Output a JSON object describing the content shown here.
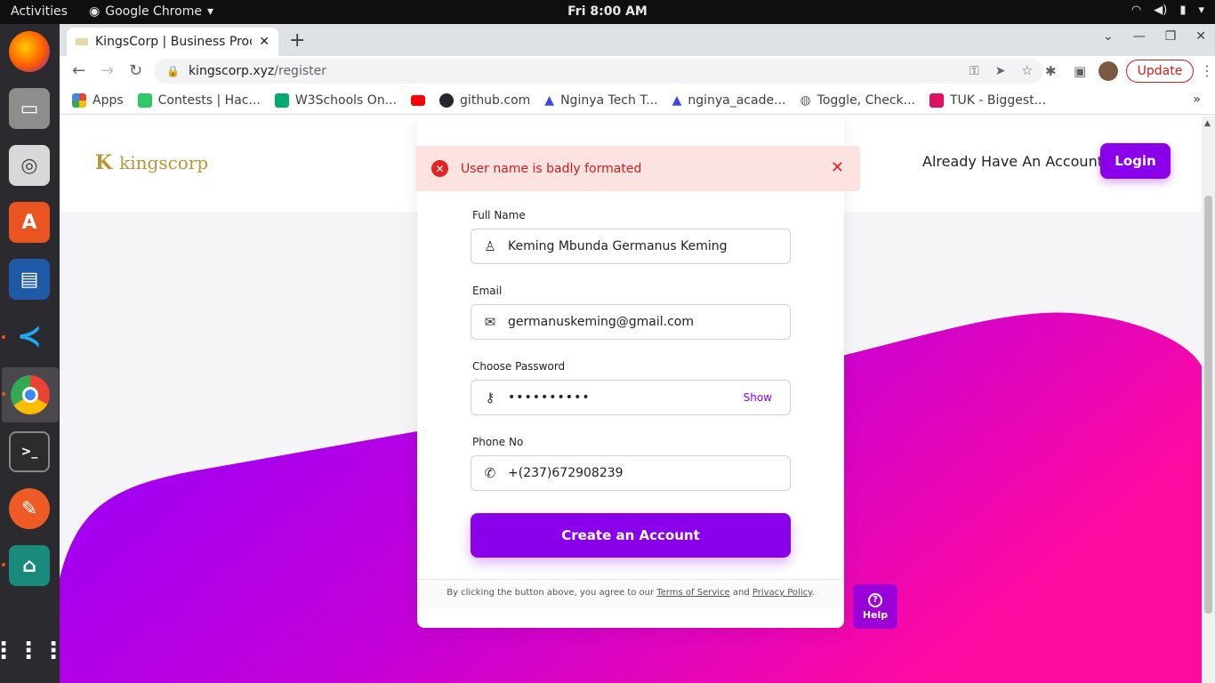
{
  "os": {
    "activities": "Activities",
    "app_name": "Google Chrome",
    "clock": "Fri  8:00 AM"
  },
  "dock": {
    "items": [
      "firefox-icon",
      "files-icon",
      "rhythmbox-icon",
      "software-center-icon",
      "writer-icon",
      "vscode-icon",
      "chrome-icon",
      "terminal-icon",
      "postman-icon",
      "android-studio-icon",
      "show-apps-icon"
    ]
  },
  "browser": {
    "tab_title": "KingsCorp | Business Proc",
    "url_host": "kingscorp.xyz",
    "url_path": "/register",
    "update_label": "Update",
    "bookmarks": [
      {
        "label": "Apps",
        "color": "#ea4335"
      },
      {
        "label": "Contests | Hac...",
        "color": "#2ec866"
      },
      {
        "label": "W3Schools On...",
        "color": "#04aa6d"
      },
      {
        "label": "",
        "color": "#ff0000"
      },
      {
        "label": "github.com",
        "color": "#24292f"
      },
      {
        "label": "Nginya Tech T...",
        "color": "#3b49df"
      },
      {
        "label": "nginya_acade...",
        "color": "#3b49df"
      },
      {
        "label": "Toggle, Check...",
        "color": "#5f6368"
      },
      {
        "label": "TUK - Biggest...",
        "color": "#e0115f"
      }
    ]
  },
  "page": {
    "logo_text": "kingscorp",
    "already_text": "Already Have An Account?",
    "login_label": "Login",
    "toast_message": "User name is badly formated",
    "form": {
      "full_name_label": "Full Name",
      "full_name_value": "Keming Mbunda Germanus Keming",
      "email_label": "Email",
      "email_value": "germanuskeming@gmail.com",
      "password_label": "Choose Password",
      "password_value": "••••••••••",
      "show_label": "Show",
      "phone_label": "Phone No",
      "phone_value": "+(237)672908239",
      "submit_label": "Create an Account"
    },
    "terms": {
      "prefix": "By clicking the button above, you agree to our ",
      "tos": "Terms of Service",
      "and": " and ",
      "privacy": "Privacy Policy",
      "suffix": "."
    },
    "help_label": "Help"
  },
  "colors": {
    "accent": "#8b00ea",
    "wave_start": "#9000ff",
    "wave_end": "#ff0aa0",
    "error": "#e02424"
  }
}
